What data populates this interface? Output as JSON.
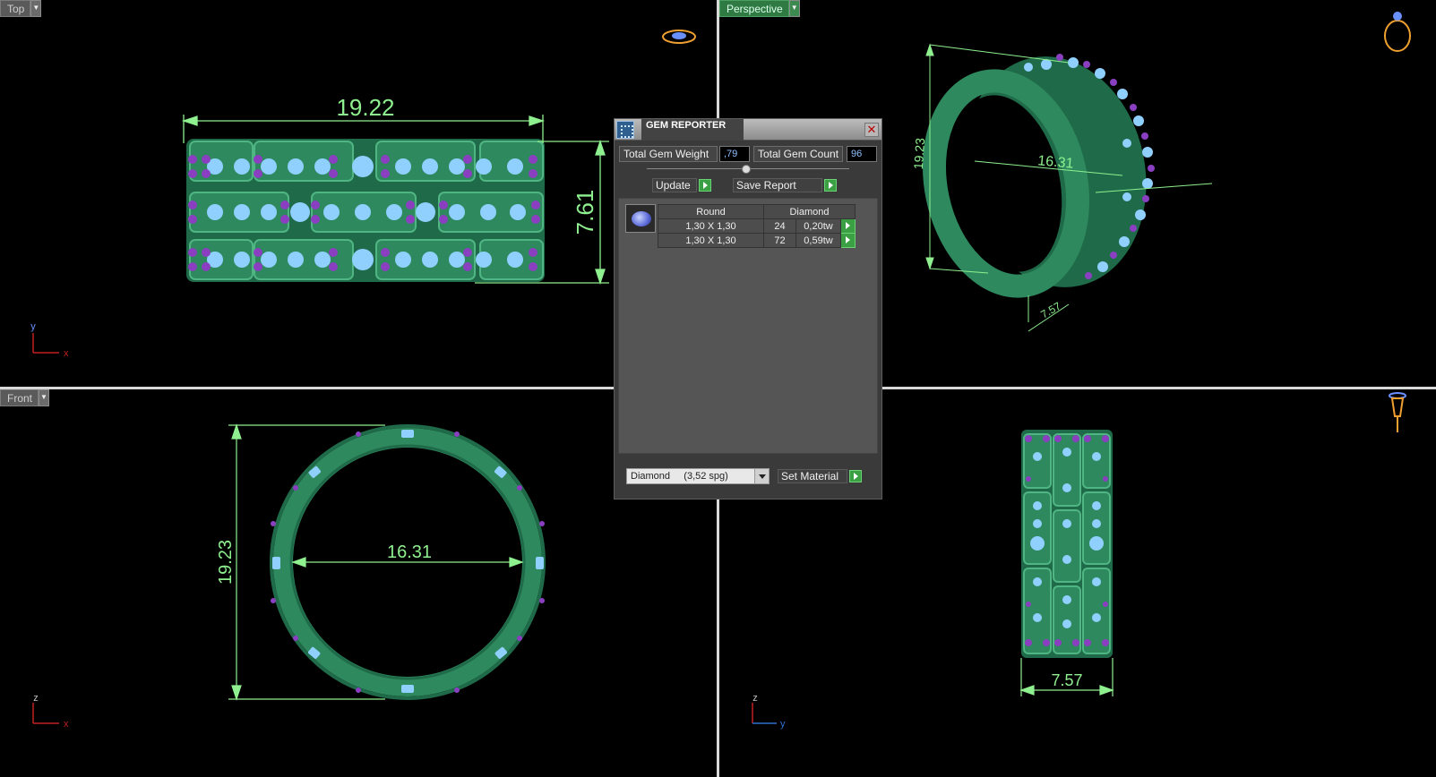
{
  "viewports": {
    "top": {
      "label": "Top",
      "dims": {
        "width": "19.22",
        "height": "7.61"
      },
      "axes": {
        "vertical": "y",
        "horizontal": "x"
      }
    },
    "perspective": {
      "label": "Perspective",
      "dims": {
        "height": "19.23",
        "diameter": "16.31",
        "width": "7.57"
      }
    },
    "front": {
      "label": "Front",
      "dims": {
        "height": "19.23",
        "diameter": "16.31"
      },
      "axes": {
        "vertical": "z",
        "horizontal": "x"
      }
    },
    "right": {
      "dims": {
        "width": "7.57"
      },
      "axes": {
        "vertical": "z",
        "horizontal": "y"
      }
    }
  },
  "dialog": {
    "title": "GEM REPORTER",
    "total_weight_label": "Total Gem Weight",
    "total_weight_value": ",79",
    "total_count_label": "Total Gem Count",
    "total_count_value": "96",
    "update_label": "Update",
    "save_report_label": "Save Report",
    "table": {
      "headers": [
        "Round",
        "Diamond"
      ],
      "rows": [
        {
          "size": "1,30 X 1,30",
          "count": "24",
          "weight": "0,20tw"
        },
        {
          "size": "1,30 X 1,30",
          "count": "72",
          "weight": "0,59tw"
        }
      ]
    },
    "material_select": "Diamond     (3,52 spg)",
    "set_material_label": "Set Material"
  },
  "colors": {
    "metal": "#2e8a5e",
    "gem_blue": "#7fc4ff",
    "gem_purple": "#8a3fc0",
    "dimension": "#8ff08f",
    "active_label": "#2f7a43"
  }
}
